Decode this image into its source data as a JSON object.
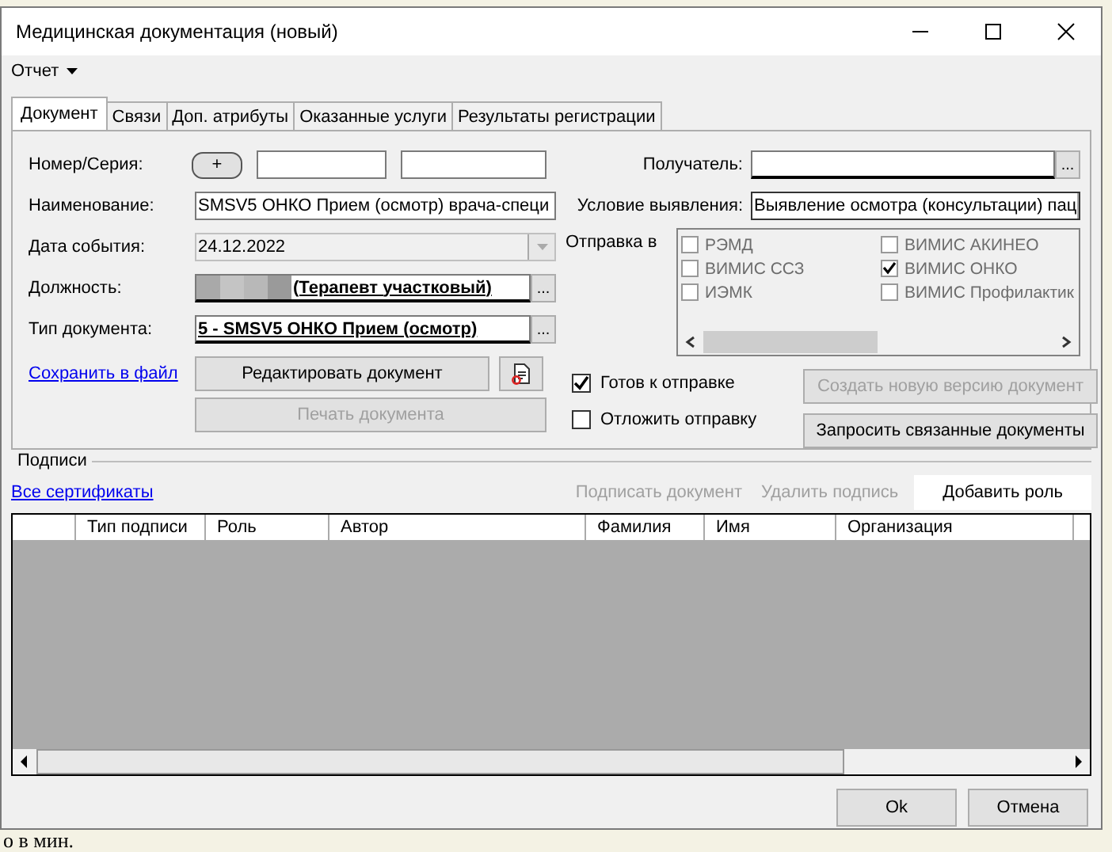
{
  "background": {
    "footer_text": "о в мин."
  },
  "window": {
    "title": "Медицинская документация (новый)"
  },
  "menu": {
    "label": "Отчет"
  },
  "tabs": [
    {
      "label": "Документ",
      "selected": true
    },
    {
      "label": "Связи",
      "selected": false
    },
    {
      "label": "Доп. атрибуты",
      "selected": false
    },
    {
      "label": "Оказанные услуги",
      "selected": false
    },
    {
      "label": "Результаты регистрации",
      "selected": false
    }
  ],
  "left_fields": [
    {
      "kind": "number",
      "label": "Номер/Серия:",
      "button": "+"
    },
    {
      "kind": "text",
      "label": "Наименование:",
      "value": "SMSV5 ОНКО Прием (осмотр) врача-специ"
    },
    {
      "kind": "date",
      "label": "Дата события:",
      "value": "24.12.2022"
    },
    {
      "kind": "lookup",
      "label": "Должность:",
      "value": "(Терапевт участковый)",
      "redacted": true,
      "button": "..."
    },
    {
      "kind": "lookup",
      "label": "Тип документа:",
      "value": "5 - SMSV5 ОНКО Прием (осмотр)",
      "redacted": false,
      "button": "..."
    }
  ],
  "save_link": "Сохранить в файл",
  "edit_button": {
    "label": "Редактировать документ",
    "disabled": false
  },
  "print_button": {
    "label": "Печать документа",
    "disabled": true
  },
  "recipient": {
    "label": "Получатель:",
    "button": "..."
  },
  "condition": {
    "label": "Условие выявления:",
    "value": "Выявление осмотра (консультации) пац"
  },
  "send_to": {
    "label": "Отправка в",
    "disabled": true,
    "options": [
      {
        "label": "РЭМД",
        "checked": false
      },
      {
        "label": "ВИМИС АКИНЕО",
        "checked": false
      },
      {
        "label": "ВИМИС ССЗ",
        "checked": false
      },
      {
        "label": "ВИМИС ОНКО",
        "checked": true
      },
      {
        "label": "ИЭМК",
        "checked": false
      },
      {
        "label": "ВИМИС Профилактик",
        "checked": false
      }
    ]
  },
  "flags": [
    {
      "label": "Готов к отправке",
      "checked": true
    },
    {
      "label": "Отложить отправку",
      "checked": false
    }
  ],
  "side_buttons": [
    {
      "label": "Создать новую версию документ",
      "disabled": true
    },
    {
      "label": "Запросить связанные документы",
      "disabled": false
    }
  ],
  "signatures": {
    "title": "Подписи",
    "link": "Все сертификаты",
    "actions": [
      {
        "label": "Подписать документ",
        "disabled": true
      },
      {
        "label": "Удалить подпись",
        "disabled": true
      },
      {
        "label": "Добавить роль",
        "disabled": false
      }
    ],
    "columns": [
      "Тип подписи",
      "Роль",
      "Автор",
      "Фамилия",
      "Имя",
      "Организация"
    ]
  },
  "footer_buttons": [
    "Ok",
    "Отмена"
  ]
}
